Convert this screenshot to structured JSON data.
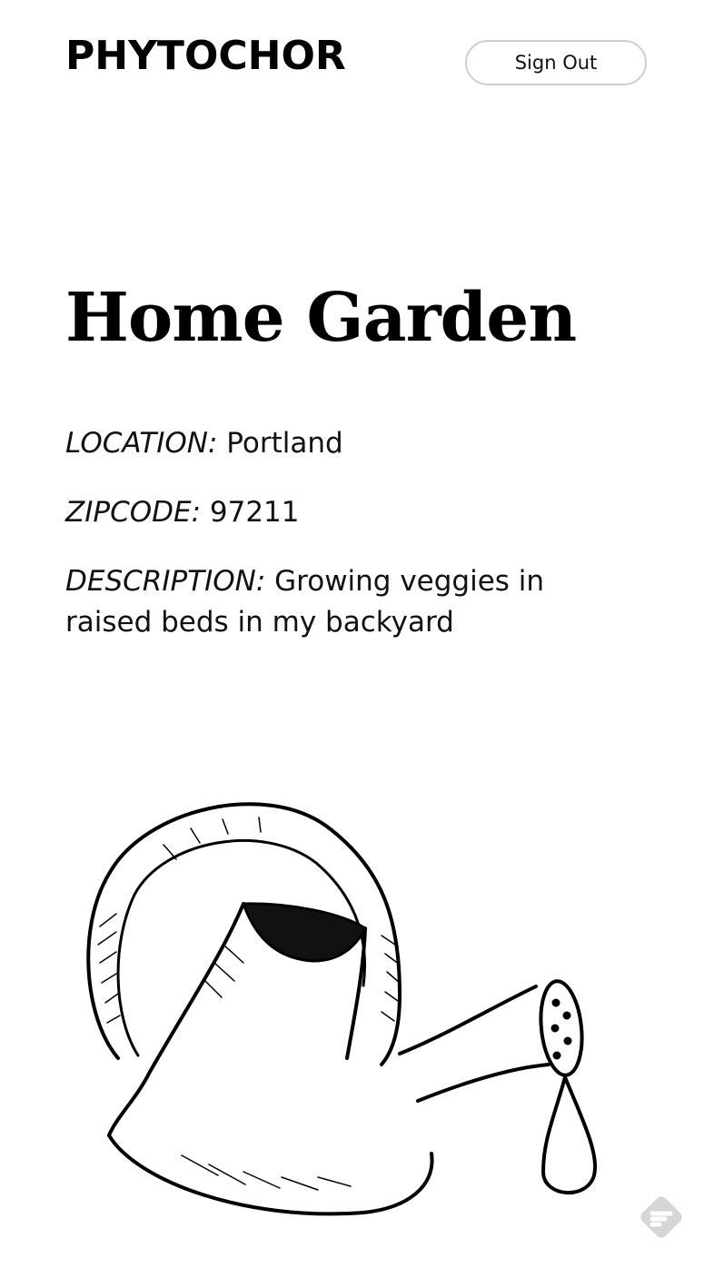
{
  "header": {
    "brand": "PHYTOCHOR",
    "sign_out_label": "Sign Out"
  },
  "garden": {
    "title": "Home Garden",
    "location_label": "LOCATION:",
    "location_value": "Portland",
    "zipcode_label": "ZIPCODE:",
    "zipcode_value": "97211",
    "description_label": "DESCRIPTION:",
    "description_value": "Growing veggies in raised beds in my backyard"
  },
  "illustration": {
    "icon": "watering-can-illustration"
  },
  "floating_badge": {
    "icon": "feedback-badge-icon",
    "color": "#d6d6d6"
  }
}
